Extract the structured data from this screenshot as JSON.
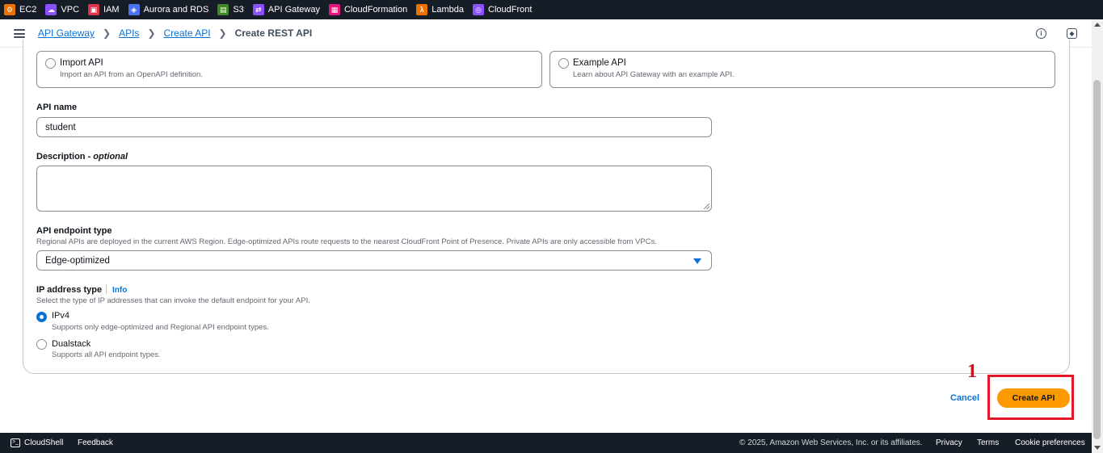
{
  "services": [
    {
      "label": "EC2",
      "icon": "ec2-icon",
      "color": "#ed7100"
    },
    {
      "label": "VPC",
      "icon": "vpc-icon",
      "color": "#8c4fff"
    },
    {
      "label": "IAM",
      "icon": "iam-icon",
      "color": "#dd344c"
    },
    {
      "label": "Aurora and RDS",
      "icon": "rds-icon",
      "color": "#4d72f3"
    },
    {
      "label": "S3",
      "icon": "s3-icon",
      "color": "#3f8624"
    },
    {
      "label": "API Gateway",
      "icon": "api-gateway-icon",
      "color": "#8c4fff"
    },
    {
      "label": "CloudFormation",
      "icon": "cloudformation-icon",
      "color": "#e7157b"
    },
    {
      "label": "Lambda",
      "icon": "lambda-icon",
      "color": "#ed7100"
    },
    {
      "label": "CloudFront",
      "icon": "cloudfront-icon",
      "color": "#8c4fff"
    }
  ],
  "breadcrumb": {
    "items": [
      "API Gateway",
      "APIs",
      "Create API"
    ],
    "current": "Create REST API"
  },
  "tiles": {
    "import": {
      "title": "Import API",
      "desc": "Import an API from an OpenAPI definition."
    },
    "example": {
      "title": "Example API",
      "desc": "Learn about API Gateway with an example API."
    }
  },
  "form": {
    "api_name_label": "API name",
    "api_name_value": "student",
    "description_label": "Description -",
    "description_optional": "optional",
    "description_value": "",
    "endpoint_label": "API endpoint type",
    "endpoint_hint": "Regional APIs are deployed in the current AWS Region. Edge-optimized APIs route requests to the nearest CloudFront Point of Presence. Private APIs are only accessible from VPCs.",
    "endpoint_value": "Edge-optimized",
    "ip_label": "IP address type",
    "ip_info": "Info",
    "ip_hint": "Select the type of IP addresses that can invoke the default endpoint for your API.",
    "ip_options": [
      {
        "title": "IPv4",
        "desc": "Supports only edge-optimized and Regional API endpoint types.",
        "selected": true
      },
      {
        "title": "Dualstack",
        "desc": "Supports all API endpoint types.",
        "selected": false
      }
    ]
  },
  "actions": {
    "cancel": "Cancel",
    "create": "Create API"
  },
  "annotation": {
    "number": "1",
    "color": "#e3172b"
  },
  "footer": {
    "cloudshell": "CloudShell",
    "feedback": "Feedback",
    "copyright": "© 2025, Amazon Web Services, Inc. or its affiliates.",
    "privacy": "Privacy",
    "terms": "Terms",
    "cookies": "Cookie preferences"
  },
  "colors": {
    "accent": "#0972d3",
    "primary_button": "#ff9900",
    "nav_bg": "#161d26"
  }
}
